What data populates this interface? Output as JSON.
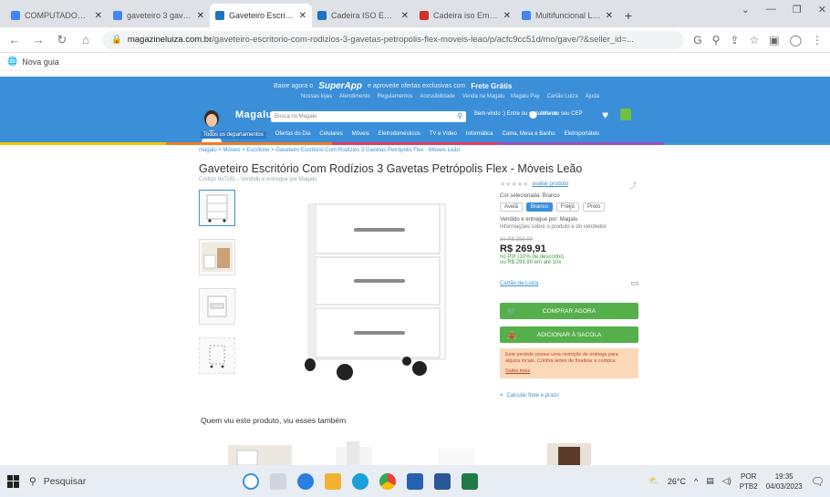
{
  "browser": {
    "tabs": [
      {
        "title": "COMPUTADOR c...",
        "color": "#4285f4",
        "active": false
      },
      {
        "title": "gaveteiro 3 gave...",
        "color": "#4285f4",
        "active": false
      },
      {
        "title": "Gaveteiro Escritó...",
        "color": "#1e73be",
        "active": true
      },
      {
        "title": "Cadeira ISO Emp...",
        "color": "#1e73be",
        "active": false
      },
      {
        "title": "Cadeira iso Empil...",
        "color": "#d03030",
        "active": false
      },
      {
        "title": "Multifuncional LC...",
        "color": "#4285f4",
        "active": false
      }
    ],
    "new_tab": "+",
    "url_domain": "magazineluiza.com.br",
    "url_path": "/gaveteiro-escritorio-com-rodizios-3-gavetas-petropolis-flex-moveis-leao/p/acfc9cc51d/mo/gave/?&seller_id=...",
    "bookmarks_label": "Nova guia"
  },
  "site": {
    "promo_prefix": "Baixe agora o",
    "promo_app": "SuperApp",
    "promo_text": "e aproveite ofertas exclusivas com",
    "promo_frete": "Frete Grátis",
    "sublinks_left": [
      "Nossas lojas",
      "Atendimento",
      "Regulamentos",
      "Acessibilidade",
      "Venda na Magalu"
    ],
    "sublinks_right": [
      "Magalu Pay",
      "Cartão Luiza",
      "Ajuda"
    ],
    "logo": "Magalu",
    "search_placeholder": "Busca no Magalu",
    "header_login": "Bem-vindo :) Entre ou cadastre-se",
    "header_cep": "Informe seu CEP",
    "categories": [
      "Todos os departamentos",
      "Ofertas do Dia",
      "Celulares",
      "Móveis",
      "Eletrodomésticos",
      "TV e Vídeo",
      "Informática",
      "Cama, Mesa e Banho",
      "Eletroportáteis"
    ],
    "breadcrumb": "magalu > Móveis > Escritório > Gaveteiro Escritório Com Rodízios 3 Gavetas Petrópolis Flex - Móveis Leão",
    "product_title": "Gaveteiro Escritório Com Rodízios 3 Gavetas Petrópolis Flex - Móveis Leão",
    "product_code": "Código 9a7c81 - Vendido e entregue por Magalu",
    "reviews_link": "avaliar produto",
    "color_label": "Cor selecionada: Branco",
    "colors": [
      "Avelã",
      "Branco",
      "Freijó",
      "Preto"
    ],
    "seller_line": "Vendido e entregue por: Magalu",
    "info_line": "Informações sobre o produto e do vendedor",
    "old_price": "de R$ 359,90",
    "price": "R$ 269,91",
    "pix_line": "no PIX (10% de desconto)",
    "installment": "ou R$ 299,90 em até 10x",
    "shipping_link": "Cartão da Luiza",
    "buy_button": "COMPRAR AGORA",
    "bag_button": "ADICIONAR À SACOLA",
    "warning_text": "Este produto possui uma restrição de entrega para alguns locais. Confira antes de finalizar a compra.",
    "warning_link": "Saiba mais",
    "calc_frete": "Calcular frete e prazo",
    "also_viewed": "Quem viu este produto, viu esses também"
  },
  "taskbar": {
    "search": "Pesquisar",
    "weather": "26°C",
    "lang_top": "POR",
    "lang_bottom": "PTB2",
    "time": "19:35",
    "date": "04/03/2023"
  },
  "colors": {
    "brand_blue": "#3b8fd8",
    "buy_green": "#55b04b",
    "warning_bg": "#fbd9b8"
  }
}
